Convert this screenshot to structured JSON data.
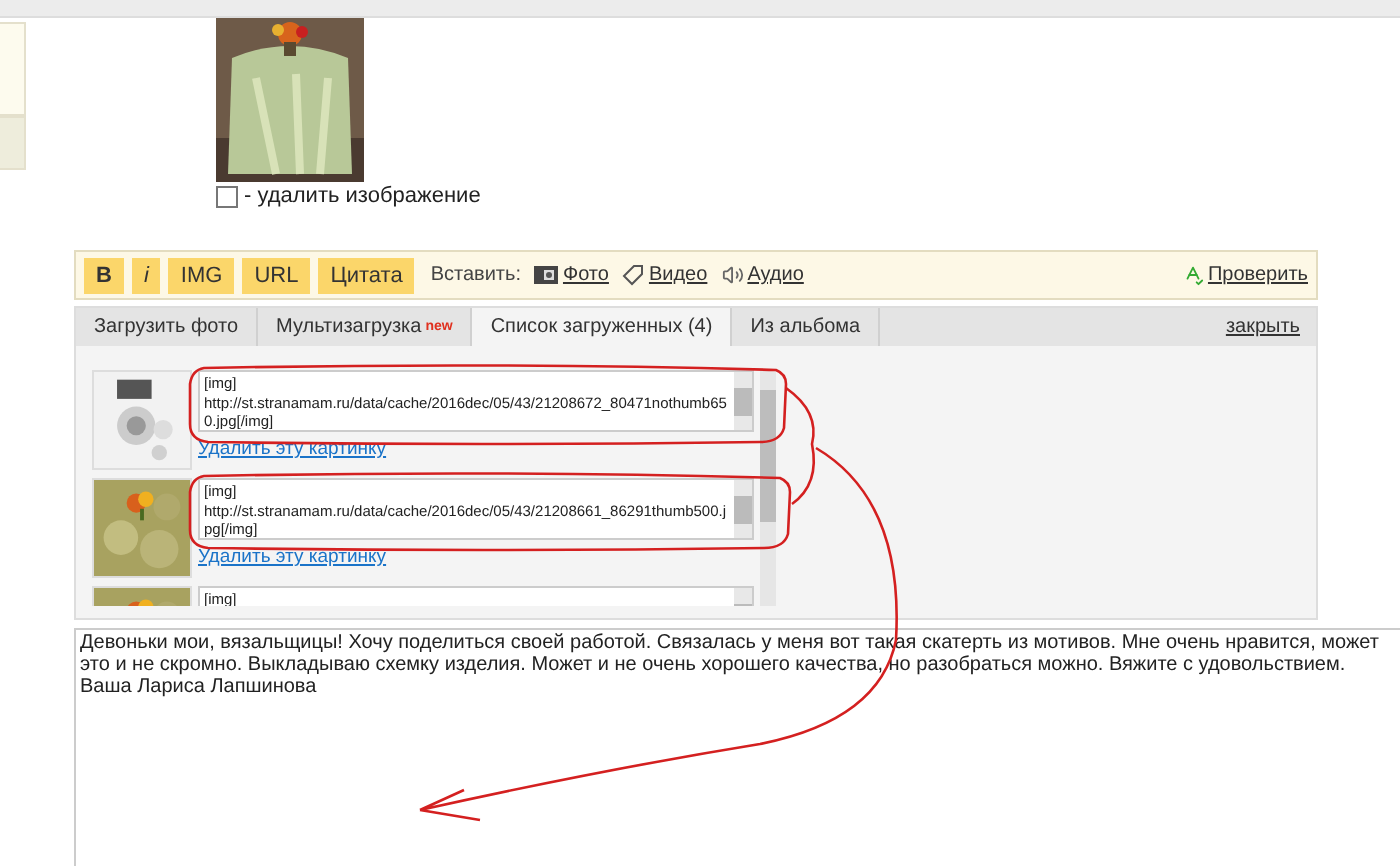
{
  "delete_image": {
    "label": "- удалить изображение",
    "checked": false
  },
  "toolbar": {
    "format_buttons": [
      {
        "kind": "bold",
        "label": "B"
      },
      {
        "kind": "italic",
        "label": "i"
      },
      {
        "kind": "plain",
        "label": "IMG"
      },
      {
        "kind": "plain",
        "label": "URL"
      },
      {
        "kind": "plain",
        "label": "Цитата"
      }
    ],
    "insert_label": "Вставить:",
    "insert_links": [
      {
        "label": "Фото"
      },
      {
        "kind": "video",
        "label": "Видео"
      },
      {
        "kind": "audio",
        "label": "Аудио"
      }
    ],
    "check_link": "Проверить"
  },
  "tabs": [
    {
      "label": "Загрузить фото",
      "selected": false
    },
    {
      "label": "Мультизагрузка",
      "badge": "new",
      "selected": false
    },
    {
      "label": "Список загруженных (4)",
      "selected": true
    },
    {
      "label": "Из альбома",
      "selected": false
    }
  ],
  "close_link": "закрыть",
  "uploads": [
    {
      "kind": "scheme",
      "code": "[img]\nhttp://st.stranamam.ru/data/cache/2016dec/05/43/21208672_80471nothumb650.jpg[/img]",
      "delete_link": "Удалить эту картинку"
    },
    {
      "code": "[img]\nhttp://st.stranamam.ru/data/cache/2016dec/05/43/21208661_86291thumb500.jpg[/img]",
      "delete_link": "Удалить эту картинку"
    },
    {
      "code": "[img]"
    }
  ],
  "message": "Девоньки мои, вязальщицы! Хочу поделиться своей работой. Связалась у меня вот такая скатерть из мотивов. Мне очень нравится, может это и не скромно. Выкладываю схемку изделия. Может и не очень хорошего качества, но разобраться можно. Вяжите с удовольствием. Ваша Лариса Лапшинова"
}
